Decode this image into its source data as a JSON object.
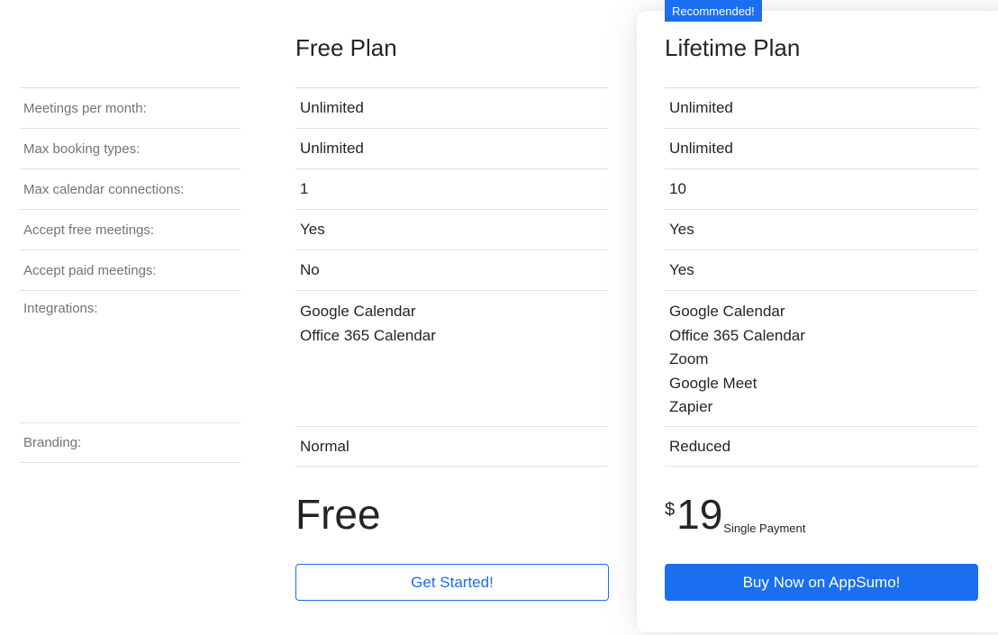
{
  "feature_labels": [
    "Meetings per month:",
    "Max booking types:",
    "Max calendar connections:",
    "Accept free meetings:",
    "Accept paid meetings:",
    "Integrations:",
    "Branding:"
  ],
  "free_plan": {
    "title": "Free Plan",
    "meetings_per_month": "Unlimited",
    "max_booking_types": "Unlimited",
    "max_calendar_connections": "1",
    "accept_free_meetings": "Yes",
    "accept_paid_meetings": "No",
    "integrations": [
      "Google Calendar",
      "Office 365 Calendar"
    ],
    "branding": "Normal",
    "price": "Free",
    "cta_label": "Get Started!"
  },
  "lifetime_plan": {
    "badge": "Recommended!",
    "title": "Lifetime Plan",
    "meetings_per_month": "Unlimited",
    "max_booking_types": "Unlimited",
    "max_calendar_connections": "10",
    "accept_free_meetings": "Yes",
    "accept_paid_meetings": "Yes",
    "integrations": [
      "Google Calendar",
      "Office 365 Calendar",
      "Zoom",
      "Google Meet",
      "Zapier"
    ],
    "branding": "Reduced",
    "price_currency": "$",
    "price_amount": "19",
    "price_note": "Single Payment",
    "cta_label": "Buy Now on AppSumo!"
  },
  "colors": {
    "accent": "#1a6ef0",
    "label_text": "#6c757d",
    "body_text": "#212529",
    "divider": "#dee2e6"
  }
}
